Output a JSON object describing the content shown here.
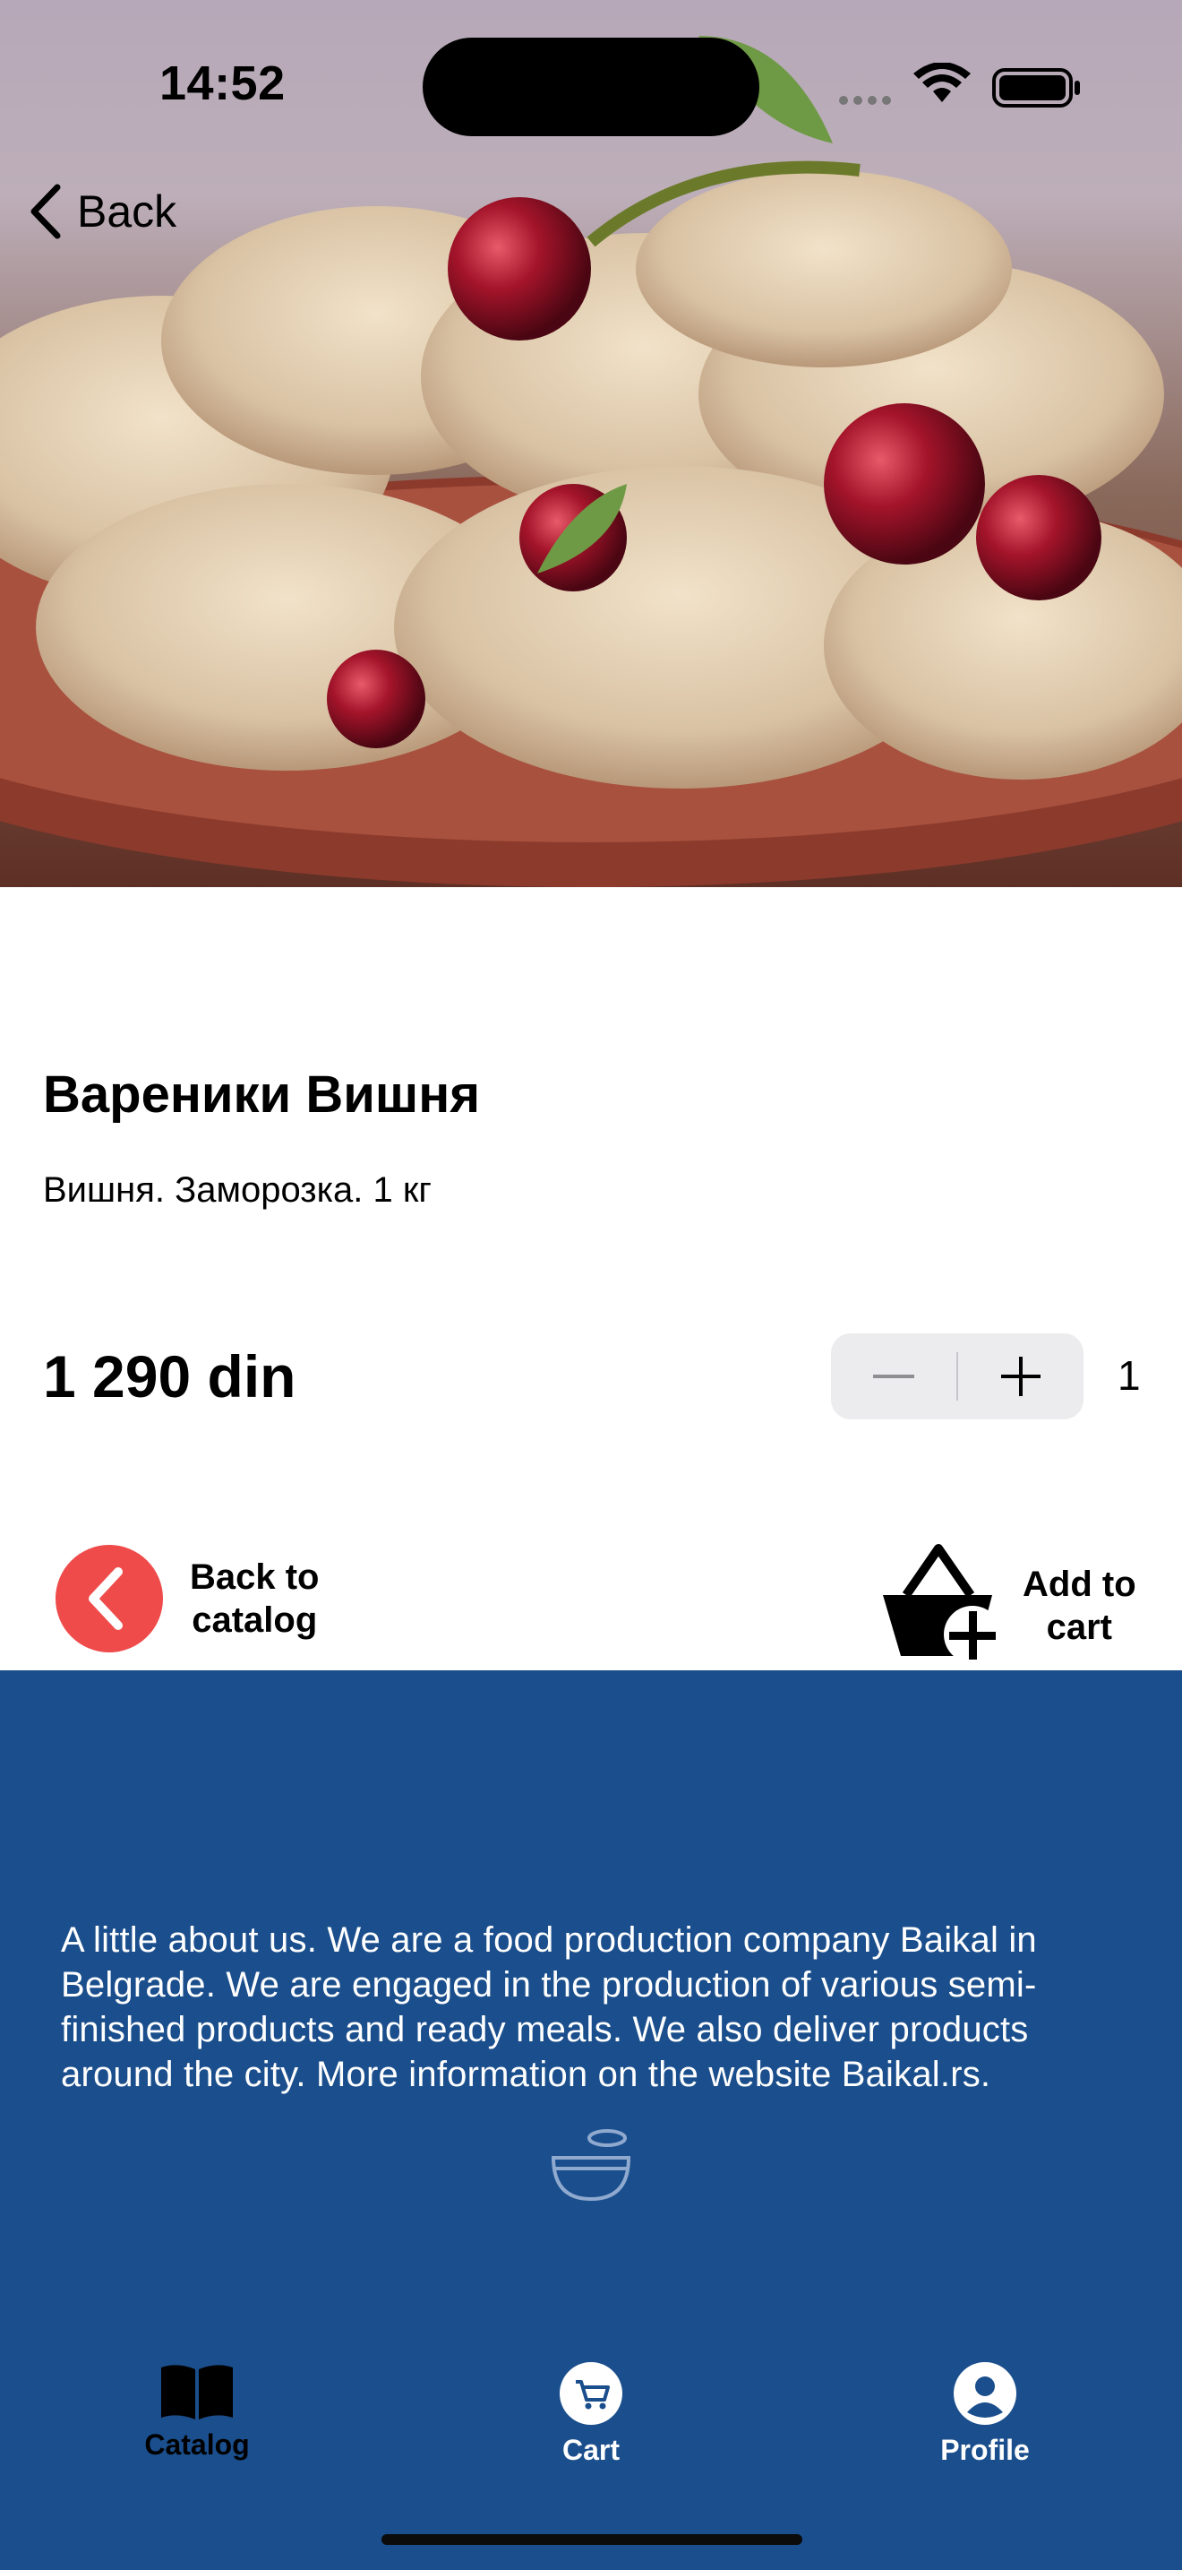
{
  "status_bar": {
    "time": "14:52"
  },
  "nav": {
    "back_label": "Back"
  },
  "product": {
    "name": "Вареники Вишня",
    "description": "Вишня. Заморозка. 1 кг",
    "price": "1 290 din",
    "quantity": "1"
  },
  "actions": {
    "back_to_catalog": [
      "Back to",
      "catalog"
    ],
    "add_to_cart": [
      "Add to",
      "cart"
    ]
  },
  "footer": {
    "about": "A little about us. We are a food production company Baikal in Belgrade. We are engaged in the production of various semi-finished products and ready meals. We also deliver products around the city. More information on the website Baikal.rs."
  },
  "tabbar": {
    "items": [
      {
        "label": "Catalog",
        "icon": "book-icon",
        "active": true
      },
      {
        "label": "Cart",
        "icon": "cart-icon",
        "active": false
      },
      {
        "label": "Profile",
        "icon": "person-icon",
        "active": false
      }
    ]
  },
  "colors": {
    "footer_bg": "#1a4e8c",
    "back_circle": "#ef4b4b",
    "tab_active": "#000000",
    "tab_inactive": "#ffffff"
  }
}
